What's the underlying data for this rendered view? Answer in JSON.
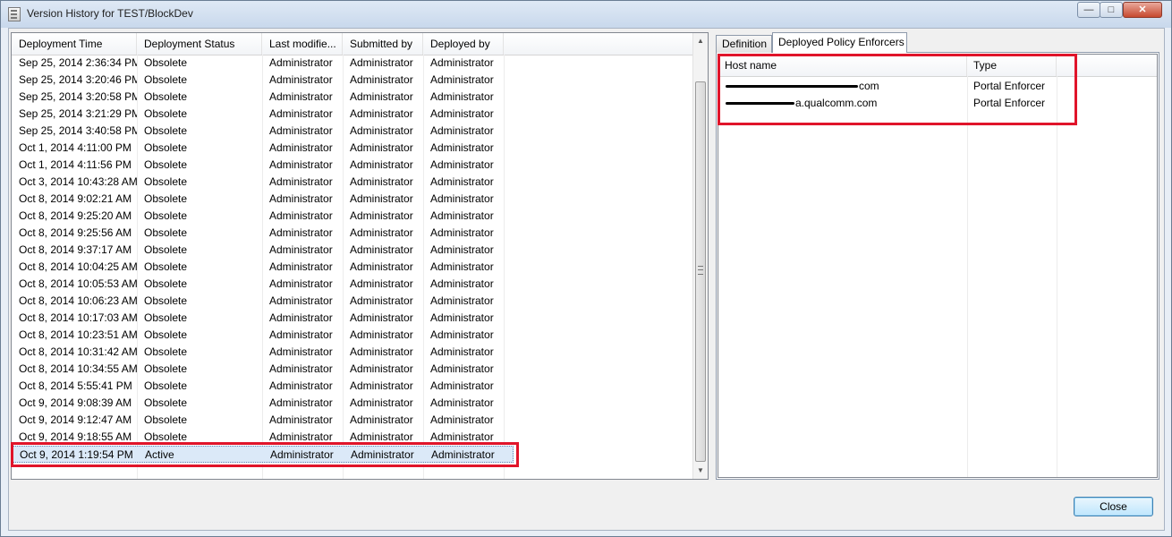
{
  "window": {
    "title": "Version History for TEST/BlockDev",
    "controls": [
      "minimize",
      "maximize",
      "close"
    ]
  },
  "history": {
    "columns": [
      "Deployment Time",
      "Deployment Status",
      "Last modifie...",
      "Submitted by",
      "Deployed by"
    ],
    "rows": [
      [
        "Sep 25, 2014 2:36:34 PM",
        "Obsolete",
        "Administrator",
        "Administrator",
        "Administrator"
      ],
      [
        "Sep 25, 2014 3:20:46 PM",
        "Obsolete",
        "Administrator",
        "Administrator",
        "Administrator"
      ],
      [
        "Sep 25, 2014 3:20:58 PM",
        "Obsolete",
        "Administrator",
        "Administrator",
        "Administrator"
      ],
      [
        "Sep 25, 2014 3:21:29 PM",
        "Obsolete",
        "Administrator",
        "Administrator",
        "Administrator"
      ],
      [
        "Sep 25, 2014 3:40:58 PM",
        "Obsolete",
        "Administrator",
        "Administrator",
        "Administrator"
      ],
      [
        "Oct 1, 2014 4:11:00 PM",
        "Obsolete",
        "Administrator",
        "Administrator",
        "Administrator"
      ],
      [
        "Oct 1, 2014 4:11:56 PM",
        "Obsolete",
        "Administrator",
        "Administrator",
        "Administrator"
      ],
      [
        "Oct 3, 2014 10:43:28 AM",
        "Obsolete",
        "Administrator",
        "Administrator",
        "Administrator"
      ],
      [
        "Oct 8, 2014 9:02:21 AM",
        "Obsolete",
        "Administrator",
        "Administrator",
        "Administrator"
      ],
      [
        "Oct 8, 2014 9:25:20 AM",
        "Obsolete",
        "Administrator",
        "Administrator",
        "Administrator"
      ],
      [
        "Oct 8, 2014 9:25:56 AM",
        "Obsolete",
        "Administrator",
        "Administrator",
        "Administrator"
      ],
      [
        "Oct 8, 2014 9:37:17 AM",
        "Obsolete",
        "Administrator",
        "Administrator",
        "Administrator"
      ],
      [
        "Oct 8, 2014 10:04:25 AM",
        "Obsolete",
        "Administrator",
        "Administrator",
        "Administrator"
      ],
      [
        "Oct 8, 2014 10:05:53 AM",
        "Obsolete",
        "Administrator",
        "Administrator",
        "Administrator"
      ],
      [
        "Oct 8, 2014 10:06:23 AM",
        "Obsolete",
        "Administrator",
        "Administrator",
        "Administrator"
      ],
      [
        "Oct 8, 2014 10:17:03 AM",
        "Obsolete",
        "Administrator",
        "Administrator",
        "Administrator"
      ],
      [
        "Oct 8, 2014 10:23:51 AM",
        "Obsolete",
        "Administrator",
        "Administrator",
        "Administrator"
      ],
      [
        "Oct 8, 2014 10:31:42 AM",
        "Obsolete",
        "Administrator",
        "Administrator",
        "Administrator"
      ],
      [
        "Oct 8, 2014 10:34:55 AM",
        "Obsolete",
        "Administrator",
        "Administrator",
        "Administrator"
      ],
      [
        "Oct 8, 2014 5:55:41 PM",
        "Obsolete",
        "Administrator",
        "Administrator",
        "Administrator"
      ],
      [
        "Oct 9, 2014 9:08:39 AM",
        "Obsolete",
        "Administrator",
        "Administrator",
        "Administrator"
      ],
      [
        "Oct 9, 2014 9:12:47 AM",
        "Obsolete",
        "Administrator",
        "Administrator",
        "Administrator"
      ],
      [
        "Oct 9, 2014 9:18:55 AM",
        "Obsolete",
        "Administrator",
        "Administrator",
        "Administrator"
      ],
      [
        "Oct 9, 2014 1:19:54 PM",
        "Active",
        "Administrator",
        "Administrator",
        "Administrator"
      ]
    ],
    "selected_row": 23
  },
  "tabs": {
    "definition": "Definition",
    "enforcers": "Deployed Policy Enforcers",
    "active": "enforcers"
  },
  "enforcers": {
    "columns": [
      "Host name",
      "Type"
    ],
    "rows": [
      {
        "host": "com",
        "type": "Portal Enforcer"
      },
      {
        "host": "a.qualcomm.com",
        "type": "Portal Enforcer"
      }
    ]
  },
  "buttons": {
    "close": "Close"
  },
  "colors": {
    "highlight": "#e0142a",
    "selection": "#dbe9f8"
  }
}
